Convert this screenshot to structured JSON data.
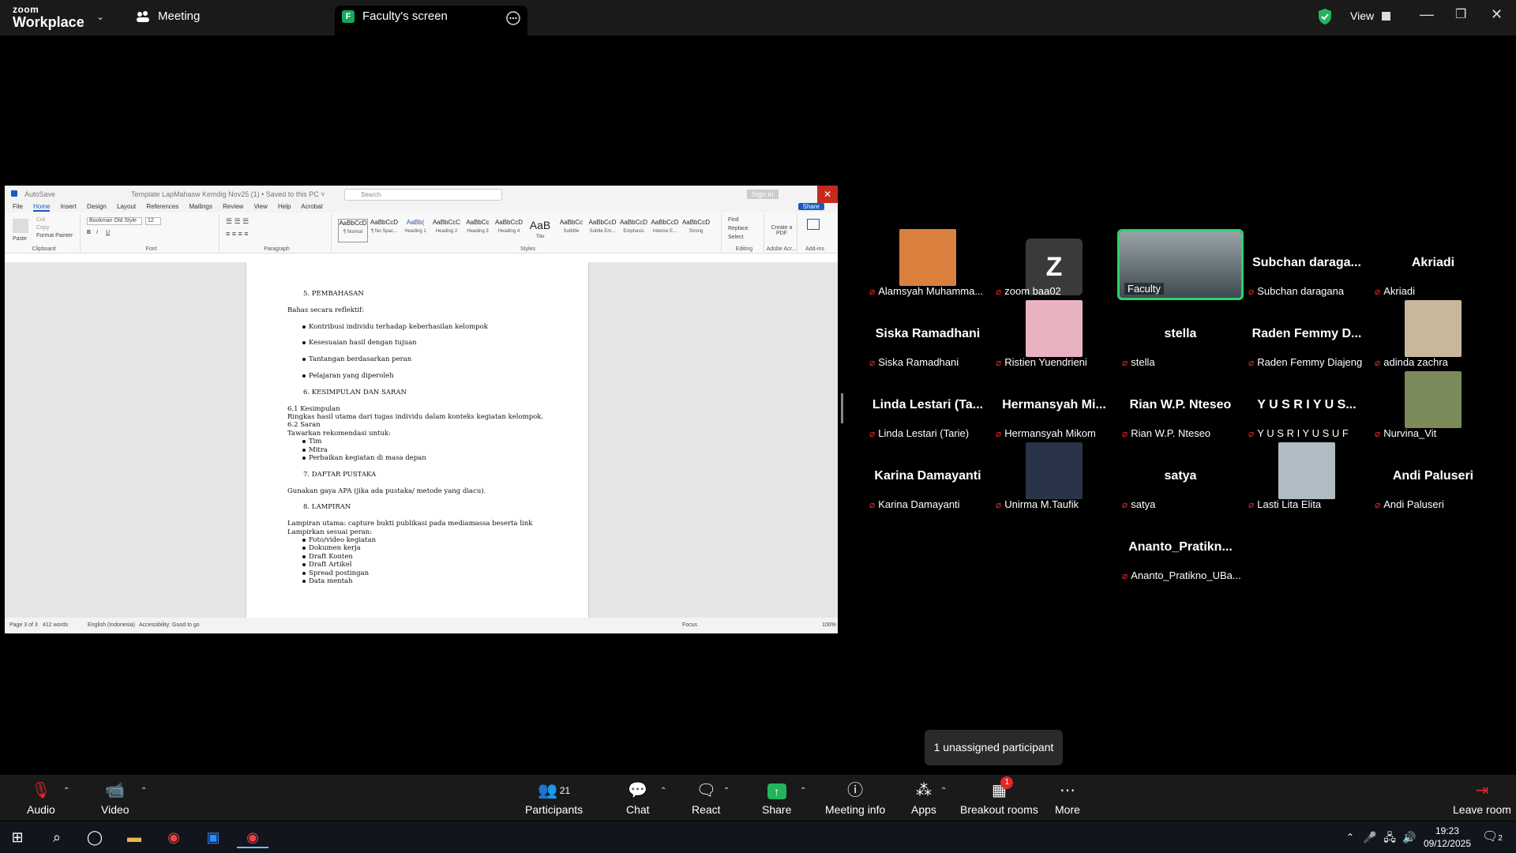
{
  "topbar": {
    "logo_top": "zoom",
    "logo_bottom": "Workplace",
    "meeting_tab": "Meeting",
    "share_tab": "Faculty's screen",
    "share_tab_badge": "F",
    "view_label": "View",
    "icons": [
      "chevron-down-icon",
      "meeting-icon",
      "more-icon",
      "shield-check-icon",
      "grid-view-icon",
      "minimize-icon",
      "maximize-icon",
      "close-icon"
    ]
  },
  "word": {
    "autosave": "AutoSave",
    "title": "Template LapMahasw Kemdig Nov25 (1) • Saved to this PC ˅",
    "search_placeholder": "Search",
    "sign_in": "Sign in",
    "tabs": [
      "File",
      "Home",
      "Insert",
      "Design",
      "Layout",
      "References",
      "Mailings",
      "Review",
      "View",
      "Help",
      "Acrobat"
    ],
    "share": "Share",
    "ribbon": {
      "paste": "Paste",
      "cut": "Cut",
      "copy": "Copy",
      "format_painter": "Format Painter",
      "clipboard": "Clipboard",
      "font_name": "Bookman Old Style",
      "font_size": "12",
      "font": "Font",
      "paragraph": "Paragraph",
      "styles_label": "Styles",
      "styles": [
        {
          "preview": "AaBbCcD",
          "name": "¶ Normal"
        },
        {
          "preview": "AaBbCcD",
          "name": "¶ No Spac..."
        },
        {
          "preview": "AaBb(",
          "name": "Heading 1"
        },
        {
          "preview": "AaBbCcC",
          "name": "Heading 2"
        },
        {
          "preview": "AaBbCc",
          "name": "Heading 3"
        },
        {
          "preview": "AaBbCcD",
          "name": "Heading 4"
        },
        {
          "preview": "AaB",
          "name": "Title"
        },
        {
          "preview": "AaBbCc",
          "name": "Subtitle"
        },
        {
          "preview": "AaBbCcD",
          "name": "Subtle Em..."
        },
        {
          "preview": "AaBbCcD",
          "name": "Emphasis"
        },
        {
          "preview": "AaBbCcD",
          "name": "Intense E..."
        },
        {
          "preview": "AaBbCcD",
          "name": "Strong"
        }
      ],
      "find": "Find",
      "replace": "Replace",
      "select": "Select",
      "editing": "Editing",
      "create_pdf": "Create a PDF",
      "adobe": "Adobe Acr...",
      "addins": "Add-ins"
    },
    "doc_lines": [
      "5.   PEMBAHASAN",
      "Bahas secara reflektif:",
      "Kontribusi individu terhadap keberhasilan kelompok",
      "Kesesuaian hasil dengan tujuan",
      "Tantangan berdasarkan peran",
      "Pelajaran yang diperoleh",
      "6.   KESIMPULAN DAN SARAN",
      "6.1 Kesimpulan",
      "Ringkas hasil utama dari tugas individu dalam konteks kegiatan kelompok.",
      "6.2 Saran",
      "Tawarkan rekomendasi untuk:",
      "Tim",
      "Mitra",
      "Perbaikan kegiatan di masa depan",
      "7.   DAFTAR PUSTAKA",
      "Gunakan gaya APA (jika ada pustaka/ metode yang diacu).",
      "8.   LAMPIRAN",
      "Lampiran utama: capture bukti publikasi pada mediamassa beserta link",
      "Lampirkan sesuai peran:",
      "Foto/video kegiatan",
      "Dokumen kerja",
      "Draft Konten",
      "Draft Artikel",
      "Spread postingan",
      "Data mentah"
    ],
    "status": {
      "page": "Page 3 of 3",
      "words": "412 words",
      "lang": "English (Indonesia)",
      "access": "Accessibility: Good to go",
      "focus": "Focus",
      "zoom": "100%"
    }
  },
  "participants": [
    {
      "display": "",
      "label": "Alamsyah Muhamma...",
      "type": "photo",
      "color": "#d9803e"
    },
    {
      "display": "Z",
      "label": "zoom baa02",
      "type": "letter"
    },
    {
      "display": "",
      "label": "Faculty",
      "type": "room",
      "selected": true
    },
    {
      "display": "Subchan daraga...",
      "label": "Subchan daragana",
      "type": "name"
    },
    {
      "display": "Akriadi",
      "label": "Akriadi",
      "type": "name"
    },
    {
      "display": "Siska Ramadhani",
      "label": "Siska Ramadhani",
      "type": "name"
    },
    {
      "display": "",
      "label": "Ristien Yuendrieni",
      "type": "photo",
      "color": "#e8b2c0"
    },
    {
      "display": "stella",
      "label": "stella",
      "type": "name"
    },
    {
      "display": "Raden Femmy D...",
      "label": "Raden Femmy Diajeng",
      "type": "name"
    },
    {
      "display": "",
      "label": "adinda zachra",
      "type": "photo",
      "color": "#c9b79a"
    },
    {
      "display": "Linda Lestari (Ta...",
      "label": "Linda Lestari (Tarie)",
      "type": "name"
    },
    {
      "display": "Hermansyah  Mi...",
      "label": "Hermansyah Mikom",
      "type": "name"
    },
    {
      "display": "Rian W.P. Nteseo",
      "label": "Rian W.P. Nteseo",
      "type": "name"
    },
    {
      "display": "Y U S R I  Y U S...",
      "label": "Y U S R I  Y U S U F",
      "type": "name"
    },
    {
      "display": "",
      "label": "Nurvina_Vit",
      "type": "photo",
      "color": "#7a8a5a"
    },
    {
      "display": "Karina Damayanti",
      "label": "Karina Damayanti",
      "type": "name"
    },
    {
      "display": "",
      "label": "Unirma M.Taufik",
      "type": "photo",
      "color": "#2a3448"
    },
    {
      "display": "satya",
      "label": "satya",
      "type": "name"
    },
    {
      "display": "",
      "label": "Lasti Lita Elita",
      "type": "photo",
      "color": "#b0bcc4"
    },
    {
      "display": "Andi Paluseri",
      "label": "Andi Paluseri",
      "type": "name"
    },
    {
      "display": "Ananto_Pratikn...",
      "label": "Ananto_Pratikno_UBa...",
      "type": "name"
    }
  ],
  "unassigned": "1 unassigned participant",
  "toolbar": {
    "audio": "Audio",
    "video": "Video",
    "participants": "Participants",
    "participants_count": "21",
    "chat": "Chat",
    "react": "React",
    "share": "Share",
    "meeting_info": "Meeting info",
    "apps": "Apps",
    "breakout": "Breakout rooms",
    "breakout_badge": "1",
    "more": "More",
    "leave": "Leave room"
  },
  "taskbar": {
    "time": "19:23",
    "date": "09/12/2025",
    "notif": "2"
  }
}
